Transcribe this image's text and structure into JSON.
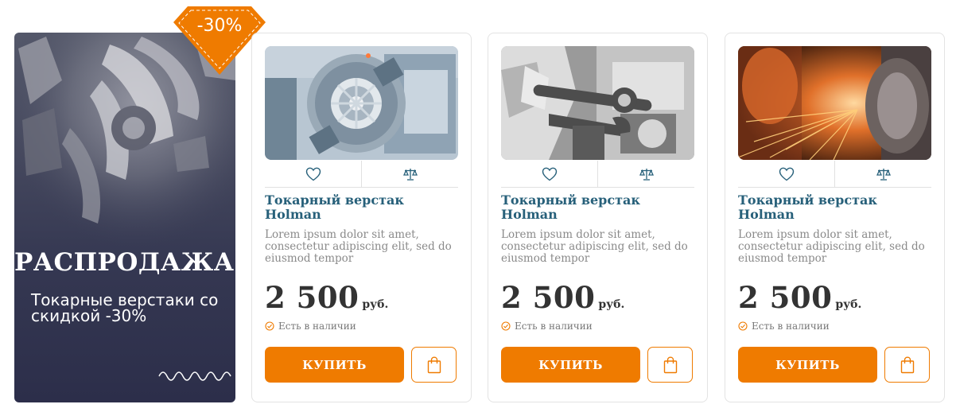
{
  "promo": {
    "badge": "-30%",
    "title": "РАСПРОДАЖА",
    "subtitle": "Токарные верстаки со скидкой -30%"
  },
  "colors": {
    "accent": "#ef7b00",
    "title": "#27607a",
    "promo_bg": "#2c2e4a"
  },
  "icons": [
    "heart-icon",
    "scales-icon",
    "check-circle-icon",
    "shopping-bag-icon",
    "wave-icon"
  ],
  "products": [
    {
      "image": "turbine-lathe-photo",
      "title": "Токарный верстак Holman",
      "description": "Lorem ipsum dolor sit amet, consectetur adipiscing elit, sed do eiusmod tempor",
      "price": "2 500",
      "currency": "руб.",
      "stock": "Есть в наличии",
      "buy_label": "КУПИТЬ"
    },
    {
      "image": "wrench-photo",
      "title": "Токарный верстак Holman",
      "description": "Lorem ipsum dolor sit amet, consectetur adipiscing elit, sed do eiusmod tempor",
      "price": "2 500",
      "currency": "руб.",
      "stock": "Есть в наличии",
      "buy_label": "КУПИТЬ"
    },
    {
      "image": "grinding-sparks-photo",
      "title": "Токарный верстак Holman",
      "description": "Lorem ipsum dolor sit amet, consectetur adipiscing elit, sed do eiusmod tempor",
      "price": "2 500",
      "currency": "руб.",
      "stock": "Есть в наличии",
      "buy_label": "КУПИТЬ"
    }
  ]
}
